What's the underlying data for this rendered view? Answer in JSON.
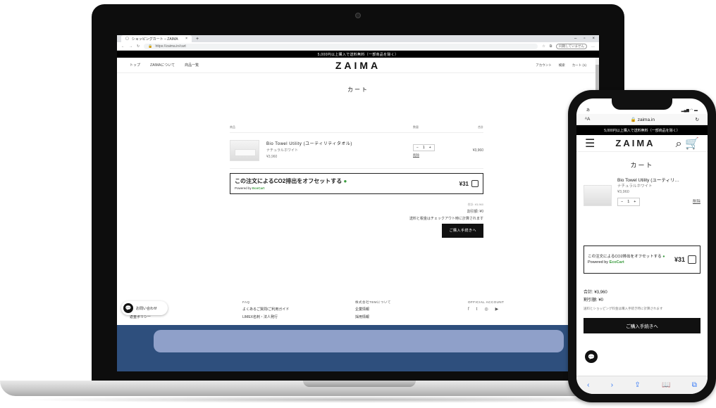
{
  "browser": {
    "tab_title": "ショッピングカート – ZAIMA",
    "url": "https://zaima.in/cart",
    "sync_label": "同期していません"
  },
  "site": {
    "announcement": "5,000円以上購入で送料無料（一部商品を除く）",
    "logo": "ZAIMA",
    "nav": [
      "トップ",
      "ZAIMAについて",
      "商品一覧"
    ],
    "nav_right": [
      "アカウント",
      "検索",
      "カート (1)"
    ],
    "cart_title": "カート",
    "headers": {
      "product": "商品",
      "quantity": "数量",
      "total": "合計"
    },
    "item": {
      "name": "Bio Towel Utility (ユーティリティタオル)",
      "variant": "ナチュラルホワイト",
      "price": "¥3,960",
      "quantity": "1",
      "remove": "削除",
      "line_total": "¥3,960"
    },
    "offset": {
      "title": "この注文によるCO2排出をオフセットする",
      "powered_by": "Powered by",
      "brand": "EcoCart",
      "price": "¥31"
    },
    "summary": {
      "strike": "合計: ¥3,960",
      "tax": "割引額: ¥0",
      "shipping_note": "送料と税金はチェックアウト時に計算されます",
      "checkout": "ご購入手続きへ"
    },
    "footer": {
      "col1": {
        "heading": "CUSTOMERS",
        "links": [
          "お問い合わせ",
          "返金ポリシー"
        ]
      },
      "col2": {
        "heading": "FAQ",
        "links": [
          "よくあるご質問/ご利用ガイド",
          "LIMEX名刺・法人発行"
        ]
      },
      "col3": {
        "heading": "株式会社TBMについて",
        "links": [
          "企業情報",
          "採用情報"
        ]
      },
      "col4": {
        "heading": "OFFICIAL ACCOUNT",
        "icons": [
          "f",
          "t",
          "◎",
          "▶"
        ]
      }
    },
    "chat_label": "お問い合わせ"
  },
  "phone": {
    "status_left": "あ",
    "domain": "zaima.in",
    "announcement": "5,000円以上購入で送料無料（一部商品を除く）",
    "logo": "ZAIMA",
    "cart_title": "カート",
    "item": {
      "name": "Bio Towel Utility (ユーティリ…",
      "variant": "ナチュラルホワイト",
      "price": "¥3,960",
      "quantity": "1",
      "remove": "削除"
    },
    "offset": {
      "title": "この注文によるCO2排出をオフセットする",
      "powered_by": "Powered by",
      "brand": "EcoCart",
      "price": "¥31"
    },
    "summary": {
      "total": "合計: ¥3,960",
      "discount": "割引額: ¥0",
      "shipping_note": "送料とショッピング料金は購入手続き時に計算されます"
    },
    "checkout": "ご購入手続きへ"
  }
}
